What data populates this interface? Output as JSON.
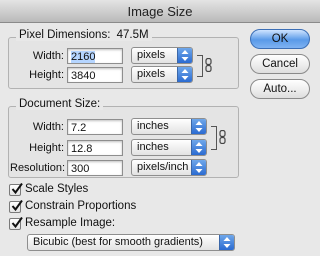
{
  "window": {
    "title": "Image Size"
  },
  "pixel_dimensions": {
    "title": "Pixel Dimensions:",
    "size": "47.5M",
    "width_label": "Width:",
    "width_value": "2160",
    "width_unit": "pixels",
    "height_label": "Height:",
    "height_value": "3840",
    "height_unit": "pixels"
  },
  "document_size": {
    "title": "Document Size:",
    "width_label": "Width:",
    "width_value": "7.2",
    "width_unit": "inches",
    "height_label": "Height:",
    "height_value": "12.8",
    "height_unit": "inches",
    "resolution_label": "Resolution:",
    "resolution_value": "300",
    "resolution_unit": "pixels/inch"
  },
  "buttons": {
    "ok": "OK",
    "cancel": "Cancel",
    "auto": "Auto..."
  },
  "options": {
    "scale_styles": {
      "label": "Scale Styles",
      "checked": true
    },
    "constrain_proportions": {
      "label": "Constrain Proportions",
      "checked": true
    },
    "resample_image": {
      "label": "Resample Image:",
      "checked": true
    },
    "resample_method": "Bicubic (best for smooth gradients)"
  }
}
